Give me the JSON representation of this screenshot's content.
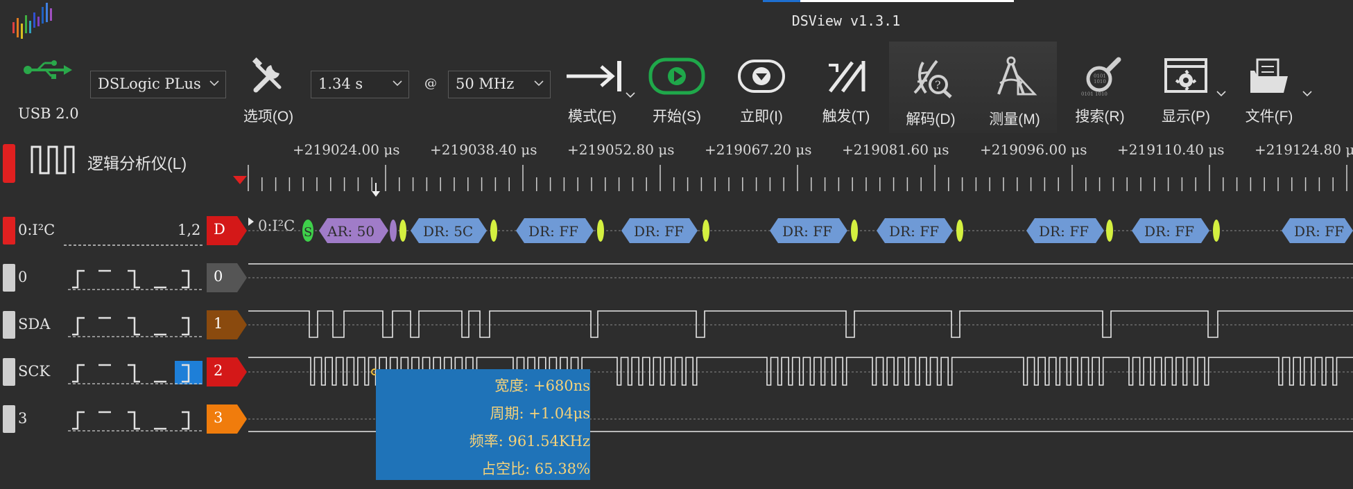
{
  "window": {
    "title": "DSView v1.3.1"
  },
  "toolbar": {
    "usb_label": "USB 2.0",
    "device": "DSLogic PLus",
    "options_label": "选项(O)",
    "sample_duration": "1.34 s",
    "at_symbol": "@",
    "sample_rate": "50 MHz",
    "buttons": [
      {
        "icon": "mode-icon",
        "label": "模式(E)"
      },
      {
        "icon": "play-icon",
        "label": "开始(S)"
      },
      {
        "icon": "instant-icon",
        "label": "立即(I)"
      },
      {
        "icon": "trigger-icon",
        "label": "触发(T)"
      },
      {
        "icon": "decode-icon",
        "label": "解码(D)"
      },
      {
        "icon": "measure-icon",
        "label": "测量(M)"
      },
      {
        "icon": "search-icon",
        "label": "搜索(R)"
      },
      {
        "icon": "display-icon",
        "label": "显示(P)"
      },
      {
        "icon": "file-icon",
        "label": "文件(F)"
      }
    ]
  },
  "ruler": {
    "mode_label": "逻辑分析仪(L)",
    "ticks": [
      "+219024.00 μs",
      "+219038.40 μs",
      "+219052.80 μs",
      "+219067.20 μs",
      "+219081.60 μs",
      "+219096.00 μs",
      "+219110.40 μs",
      "+219124.80 μ"
    ]
  },
  "decoder": {
    "name": "0:I²C",
    "channels": "1,2",
    "tag": "D",
    "row_label": "0:I²C",
    "annotations": [
      "S",
      "AR: 50",
      "DR: 5C",
      "DR: FF",
      "DR: FF",
      "DR: FF",
      "DR: FF",
      "DR: FF",
      "DR: FF",
      "DR: FF"
    ]
  },
  "channels": [
    {
      "name": "0",
      "tag": "0",
      "color": "#555555"
    },
    {
      "name": "SDA",
      "tag": "1",
      "color": "#8a4a0e"
    },
    {
      "name": "SCK",
      "tag": "2",
      "color": "#d41818"
    },
    {
      "name": "3",
      "tag": "3",
      "color": "#f07c0c"
    }
  ],
  "measurement": {
    "width": "宽度: +680ns",
    "period": "周期: +1.04μs",
    "frequency": "频率: 961.54KHz",
    "duty": "占空比: 65.38%"
  }
}
